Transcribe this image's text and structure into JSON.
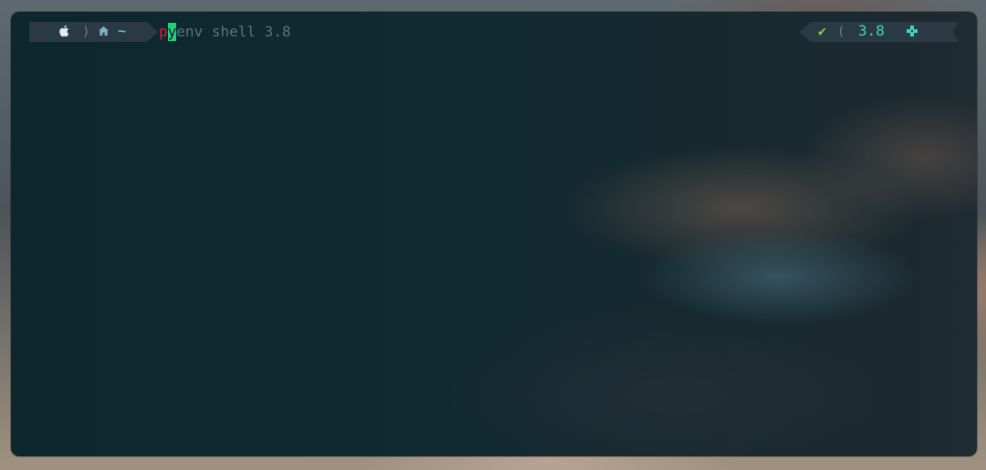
{
  "terminal": {
    "prompt_left": {
      "os_icon": "apple-icon",
      "dir_icon": "home-icon",
      "directory": "~",
      "separator": ")"
    },
    "command": {
      "typed_first": "p",
      "cursor_char": "y",
      "rest": "env shell 3.8"
    },
    "prompt_right": {
      "status_icon": "check-icon",
      "status_symbol": "✔",
      "separator": "(",
      "python_version": "3.8",
      "lang_icon": "python-icon"
    }
  },
  "colors": {
    "segment_bg": "#2a3a44",
    "error_red": "#e0183e",
    "cursor_green": "#22d07a",
    "dir_blue": "#5fb4d9",
    "ok_green": "#7fd44a",
    "version_teal": "#3fd6b8",
    "command_text": "#58727e"
  }
}
